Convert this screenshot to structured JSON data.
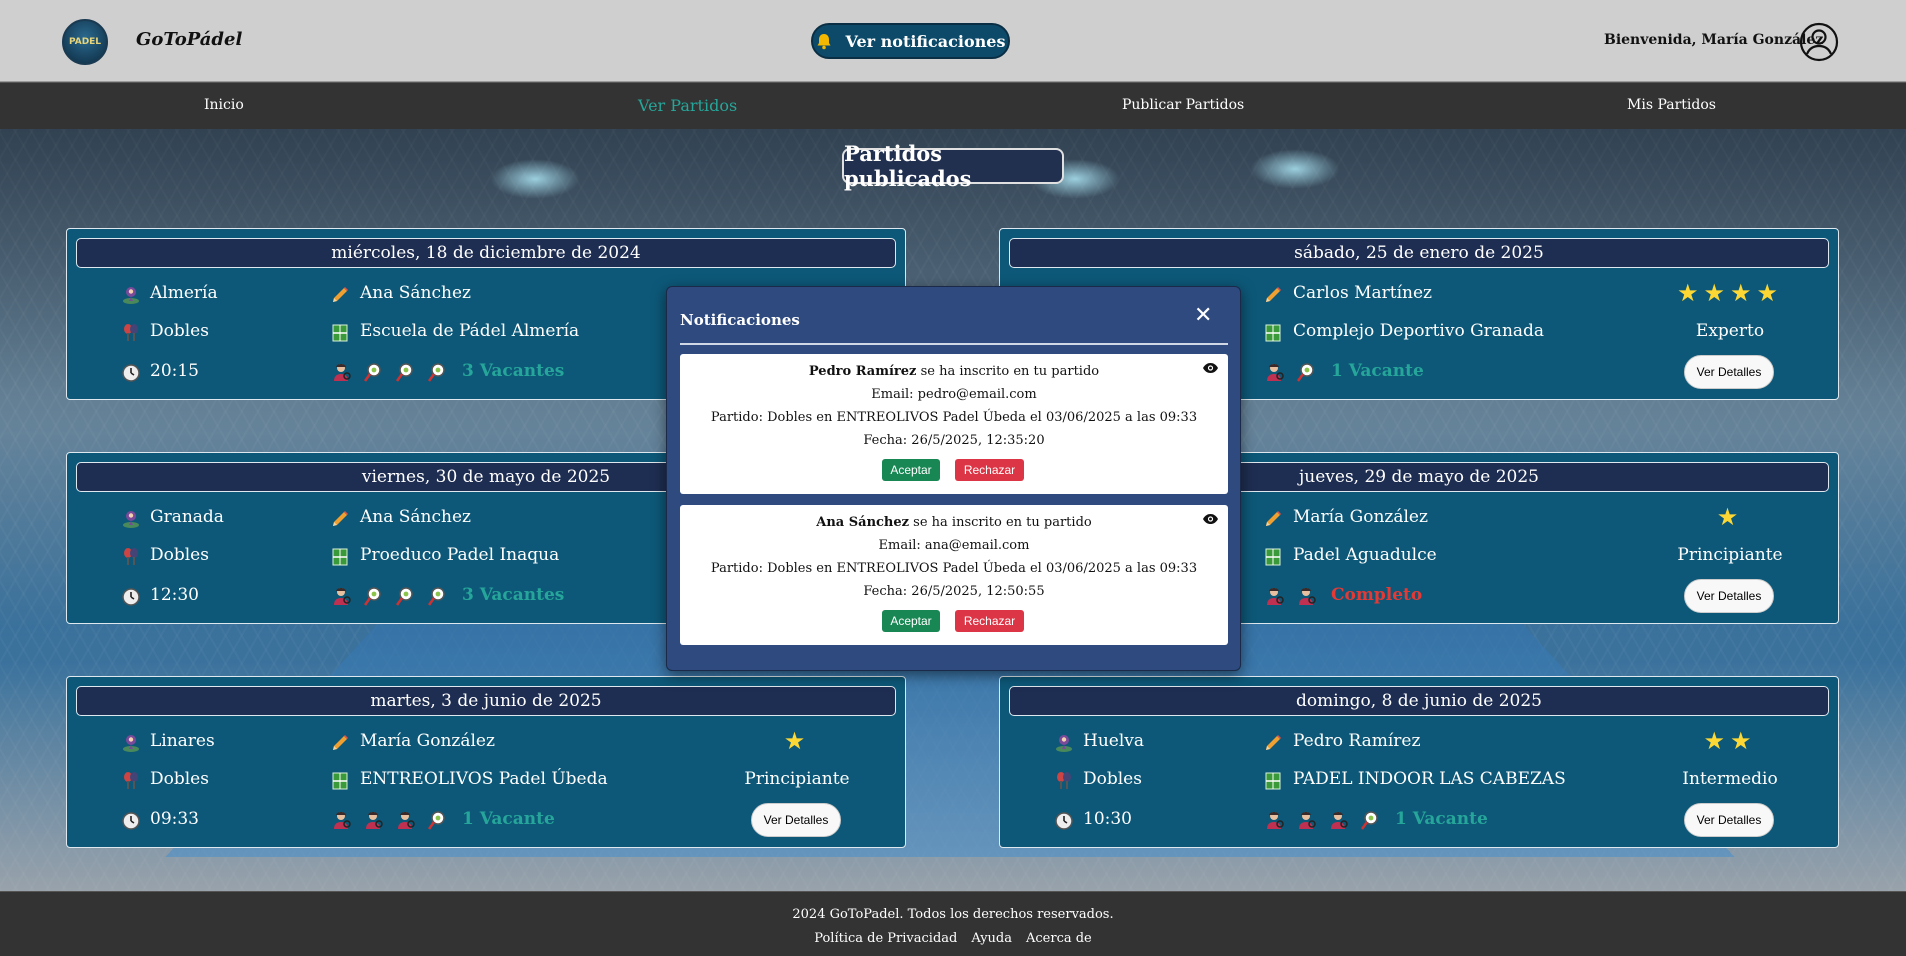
{
  "header": {
    "logo_text": "PADEL",
    "brand": "GoToPádel",
    "notifications_button": "Ver notificaciones",
    "welcome": "Bienvenida, María González"
  },
  "nav": {
    "items": [
      "Inicio",
      "Ver Partidos",
      "Publicar Partidos",
      "Mis Partidos"
    ],
    "active": "Ver Partidos"
  },
  "page_title": "Partidos publicados",
  "matches": [
    {
      "date": "miércoles, 18 de diciembre de 2024",
      "city": "Almería",
      "creator": "Ana Sánchez",
      "type": "Dobles",
      "venue": "Escuela de Pádel Almería",
      "time": "20:15",
      "filled": 1,
      "empty": 3,
      "vacancies": "3 Vacantes",
      "status": "open",
      "stars": 0,
      "level": "",
      "details_label": ""
    },
    {
      "date": "sábado, 25 de enero de 2025",
      "city": "",
      "creator": "Carlos Martínez",
      "type": "",
      "venue": "Complejo Deportivo Granada",
      "time": "",
      "filled": 1,
      "empty": 1,
      "vacancies": "1 Vacante",
      "status": "open",
      "stars": 4,
      "level": "Experto",
      "details_label": "Ver Detalles"
    },
    {
      "date": "viernes, 30 de mayo de 2025",
      "city": "Granada",
      "creator": "Ana Sánchez",
      "type": "Dobles",
      "venue": "Proeduco Padel Inaqua",
      "time": "12:30",
      "filled": 1,
      "empty": 3,
      "vacancies": "3 Vacantes",
      "status": "open",
      "stars": 0,
      "level": "",
      "details_label": ""
    },
    {
      "date": "jueves, 29 de mayo de 2025",
      "city": "",
      "creator": "María González",
      "type": "",
      "venue": "Padel Aguadulce",
      "time": "",
      "filled": 2,
      "empty": 0,
      "vacancies": "Completo",
      "status": "full",
      "stars": 1,
      "level": "Principiante",
      "details_label": "Ver Detalles"
    },
    {
      "date": "martes, 3 de junio de 2025",
      "city": "Linares",
      "creator": "María González",
      "type": "Dobles",
      "venue": "ENTREOLIVOS Padel Úbeda",
      "time": "09:33",
      "filled": 3,
      "empty": 1,
      "vacancies": "1 Vacante",
      "status": "open",
      "stars": 1,
      "level": "Principiante",
      "details_label": "Ver Detalles"
    },
    {
      "date": "domingo, 8 de junio de 2025",
      "city": "Huelva",
      "creator": "Pedro Ramírez",
      "type": "Dobles",
      "venue": "PADEL INDOOR LAS CABEZAS",
      "time": "10:30",
      "filled": 3,
      "empty": 1,
      "vacancies": "1 Vacante",
      "status": "open",
      "stars": 2,
      "level": "Intermedio",
      "details_label": "Ver Detalles"
    }
  ],
  "modal": {
    "title": "Notificaciones",
    "close_symbol": "✕",
    "notifications": [
      {
        "name": "Pedro Ramírez",
        "action": " se ha inscrito en tu partido",
        "email": "Email: pedro@email.com",
        "match": "Partido: Dobles en ENTREOLIVOS Padel Úbeda el 03/06/2025 a las 09:33",
        "date": "Fecha: 26/5/2025, 12:35:20",
        "accept": "Aceptar",
        "reject": "Rechazar"
      },
      {
        "name": "Ana Sánchez",
        "action": " se ha inscrito en tu partido",
        "email": "Email: ana@email.com",
        "match": "Partido: Dobles en ENTREOLIVOS Padel Úbeda el 03/06/2025 a las 09:33",
        "date": "Fecha: 26/5/2025, 12:50:55",
        "accept": "Aceptar",
        "reject": "Rechazar"
      }
    ]
  },
  "footer": {
    "copyright": "2024 GoToPadel. Todos los derechos reservados.",
    "links": [
      "Política de Privacidad",
      "Ayuda",
      "Acerca de"
    ]
  },
  "colors": {
    "header_bg": "#cfcfcf",
    "nav_bg": "#333333",
    "nav_active": "#26a69a",
    "card_bg": "#0d5878",
    "date_bg": "#1e2d52",
    "vacancy_open": "#26a69a",
    "vacancy_full": "#e53935",
    "star": "#fdd835",
    "modal_bg": "#2e4a7e",
    "accept": "#198754",
    "reject": "#dc3545"
  },
  "icons": {
    "city": "map-pin-icon",
    "creator": "pencil-icon",
    "type": "rackets-icon",
    "venue": "court-icon",
    "time": "clock-icon",
    "player": "player-icon",
    "empty_slot": "empty-slot-icon",
    "view": "eye-icon",
    "bell": "bell-icon",
    "user": "user-icon"
  }
}
